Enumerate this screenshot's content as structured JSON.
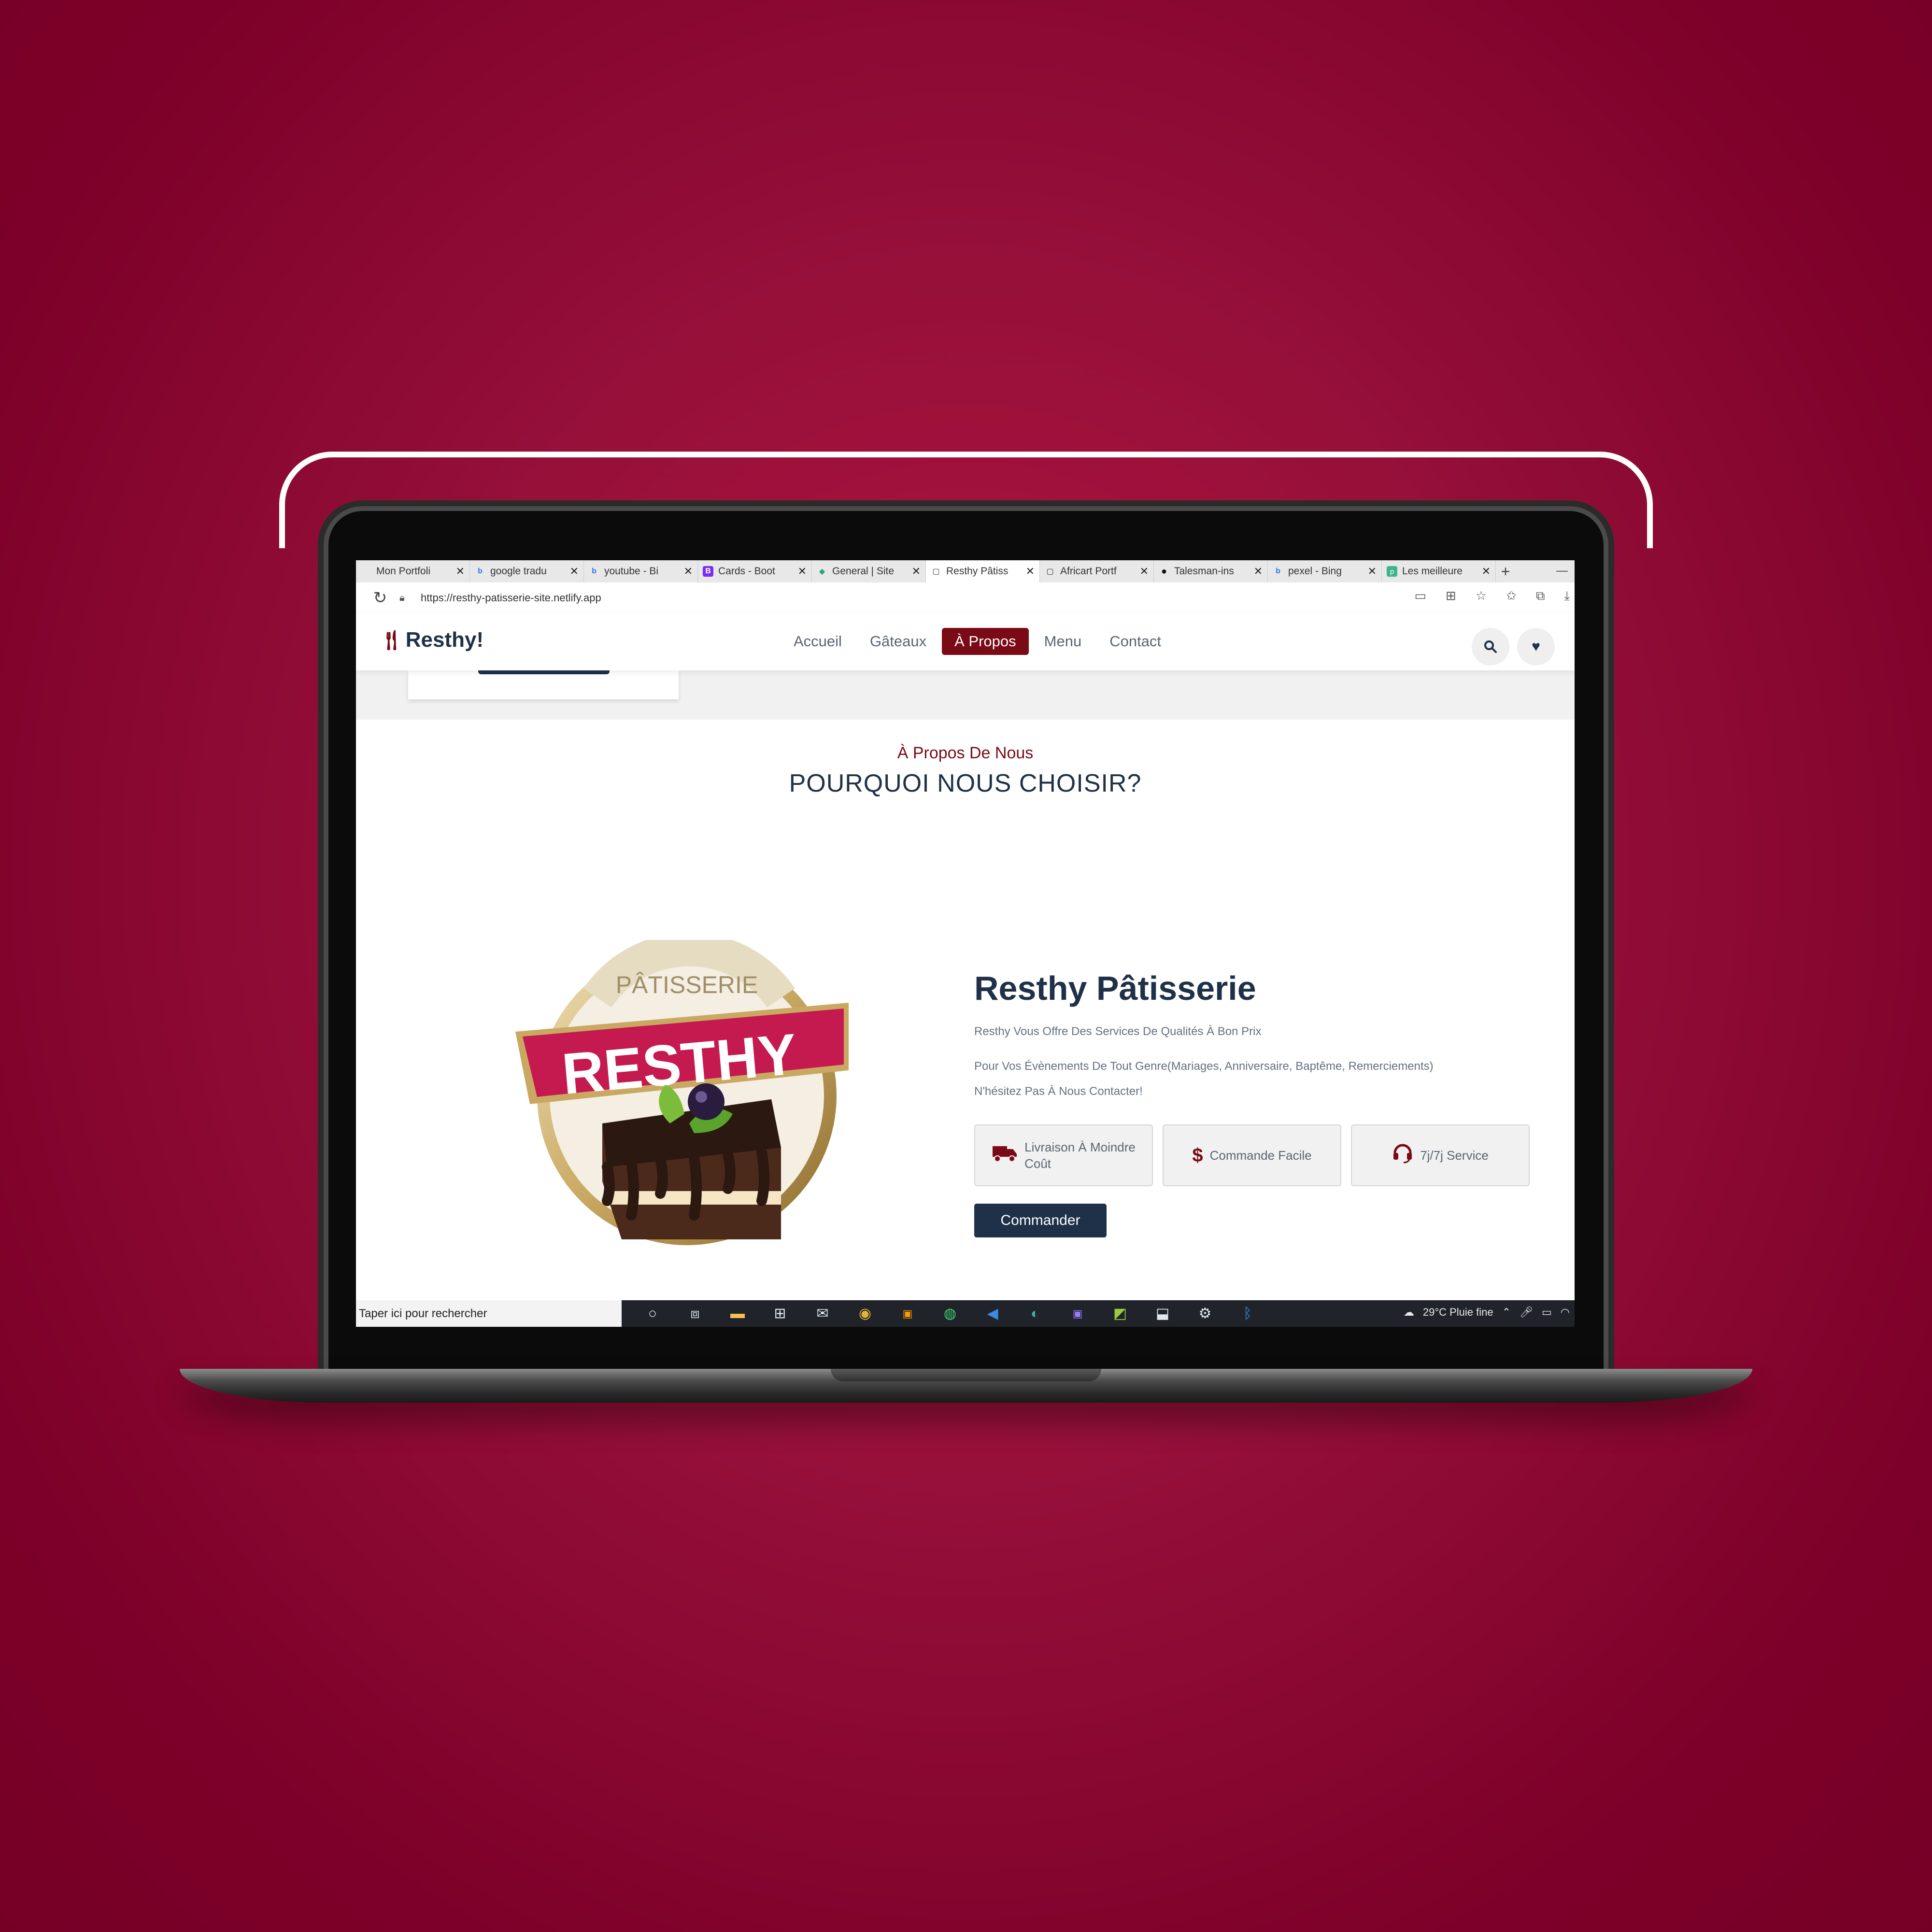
{
  "browser": {
    "tabs": [
      {
        "label": "Mon Portfoli",
        "icon": "page-icon",
        "fav_color": "#e8e8e8",
        "fav_text": ""
      },
      {
        "label": "google tradu",
        "icon": "bing-icon",
        "fav_color": "#e8e8e8",
        "fav_text": "b"
      },
      {
        "label": "youtube - Bi",
        "icon": "bing-icon",
        "fav_color": "#e8e8e8",
        "fav_text": "b"
      },
      {
        "label": "Cards - Boot",
        "icon": "bootstrap-icon",
        "fav_color": "#7a2cf0",
        "fav_text": "B"
      },
      {
        "label": "General | Site",
        "icon": "diamond-icon",
        "fav_color": "#e8e8e8",
        "fav_text": "◆"
      },
      {
        "label": "Resthy Pâtiss",
        "icon": "page-icon",
        "fav_color": "#ffffff",
        "fav_text": "▢",
        "active": true
      },
      {
        "label": "Africart Portf",
        "icon": "page-icon",
        "fav_color": "#e8e8e8",
        "fav_text": "▢"
      },
      {
        "label": "Talesman-ins",
        "icon": "github-icon",
        "fav_color": "#e8e8e8",
        "fav_text": "●"
      },
      {
        "label": "pexel - Bing",
        "icon": "bing-icon",
        "fav_color": "#e8e8e8",
        "fav_text": "b"
      },
      {
        "label": "Les meilleure",
        "icon": "site-icon",
        "fav_color": "#3bb58a",
        "fav_text": "p"
      }
    ],
    "tab_close_symbol": "✕",
    "new_tab_symbol": "+",
    "minimize_symbol": "—",
    "url": "https://resthy-patisserie-site.netlify.app"
  },
  "site": {
    "logo_text": "Resthy!",
    "nav": [
      {
        "label": "Accueil",
        "active": false
      },
      {
        "label": "Gâteaux",
        "active": false
      },
      {
        "label": "À Propos",
        "active": true
      },
      {
        "label": "Menu",
        "active": false
      },
      {
        "label": "Contact",
        "active": false
      }
    ],
    "about": {
      "subtitle": "À Propos De Nous",
      "title": "POURQUOI NOUS CHOISIR?",
      "badge_top_text": "PÂTISSERIE",
      "badge_banner_text": "RESTHY",
      "brand_title": "Resthy Pâtisserie",
      "paragraph_1": "Resthy Vous Offre Des Services De Qualités À Bon Prix",
      "paragraph_2": "Pour Vos Évènements De Tout Genre(Mariages, Anniversaire, Baptême, Remerciements)",
      "paragraph_3": "N'hésitez Pas À Nous Contacter!",
      "features": [
        {
          "icon": "truck-icon",
          "line1": "Livraison À Moindre",
          "line2": "Coût"
        },
        {
          "icon": "dollar-icon",
          "line1": "Commande Facile",
          "line2": ""
        },
        {
          "icon": "headset-icon",
          "line1": "7j/7j Service",
          "line2": ""
        }
      ],
      "order_button": "Commander"
    }
  },
  "taskbar": {
    "search_placeholder": "Taper ici pour rechercher",
    "weather": "29°C  Pluie fine"
  },
  "colors": {
    "accent": "#7a0a15",
    "navy": "#1e3148",
    "background": "#96103a"
  }
}
